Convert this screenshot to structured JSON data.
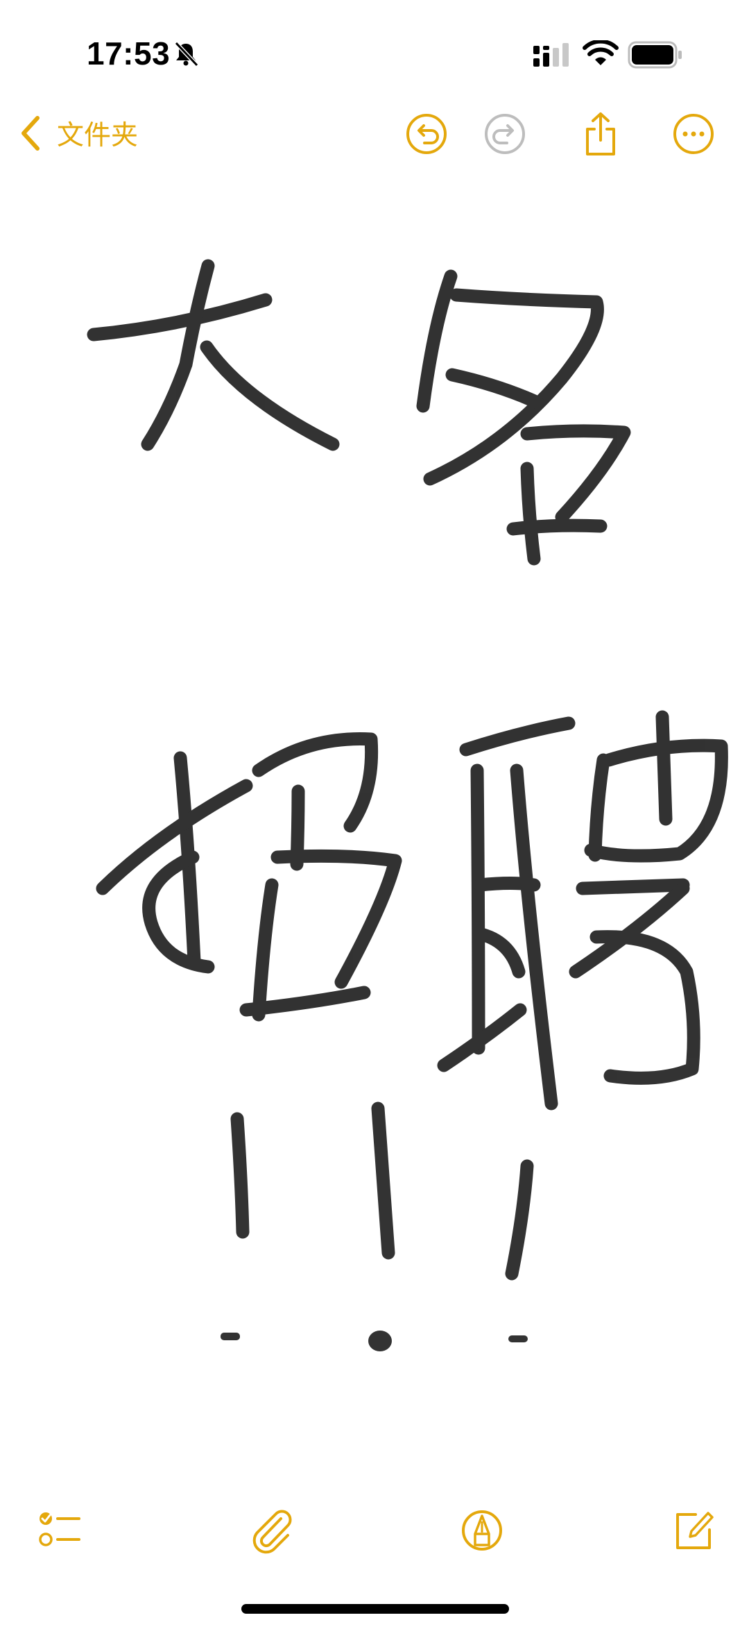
{
  "status_bar": {
    "time": "17:53",
    "icons": [
      "bell-slash-icon",
      "cellular-signal-icon",
      "wifi-icon",
      "battery-icon"
    ]
  },
  "nav": {
    "back_label": "文件夹",
    "buttons": [
      "undo-icon",
      "redo-icon",
      "share-icon",
      "more-icon"
    ]
  },
  "note": {
    "content_type": "handwritten-drawing",
    "handwriting_text": "大多招聘!!!"
  },
  "toolbar": {
    "buttons": [
      "checklist-icon",
      "paperclip-icon",
      "markup-pen-icon",
      "compose-icon"
    ]
  },
  "colors": {
    "accent": "#E4A80C",
    "disabled": "#BDBDBD",
    "ink": "#111111",
    "background": "#FFFFFF"
  }
}
